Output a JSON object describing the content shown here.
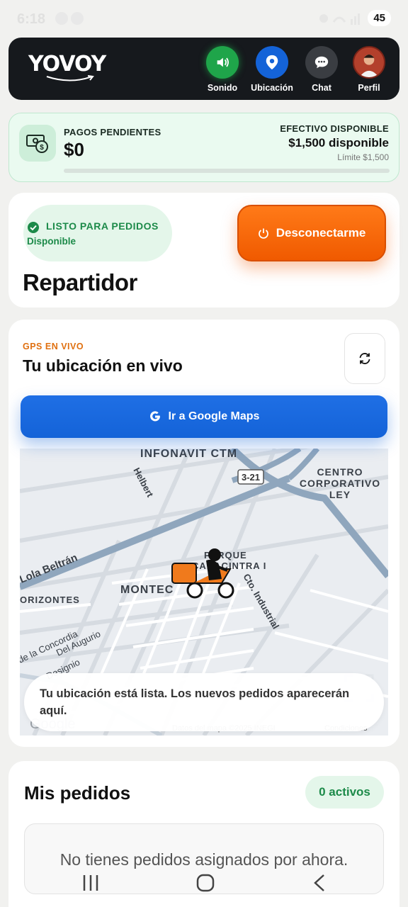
{
  "status_bar": {
    "time": "6:18",
    "battery": "45"
  },
  "header": {
    "logo": "YOVOY",
    "buttons": [
      {
        "label": "Sonido",
        "icon": "speaker-icon",
        "color": "#1fa54a"
      },
      {
        "label": "Ubicación",
        "icon": "location-pin-icon",
        "color": "#1463d8"
      },
      {
        "label": "Chat",
        "icon": "chat-bubble-icon",
        "color": "#3a3d42"
      },
      {
        "label": "Perfil",
        "icon": "avatar",
        "color": "#a33323"
      }
    ]
  },
  "pagos": {
    "title": "PAGOS PENDIENTES",
    "value": "$0",
    "efectivo_title": "EFECTIVO DISPONIBLE",
    "efectivo_value": "$1,500 disponible",
    "limite": "Límite $1,500",
    "progress_fraction": 0.0
  },
  "status": {
    "badge_title": "LISTO PARA PEDIDOS",
    "badge_sub": "Disponible",
    "disconnect_label": "Desconectarme",
    "role": "Repartidor"
  },
  "gps": {
    "label": "GPS EN VIVO",
    "title": "Tu ubicación en vivo",
    "maps_button": "Ir a Google Maps",
    "map_labels": {
      "infonavit": "INFONAVIT CTM",
      "centro": "CENTRO",
      "corporativo": "CORPORATIVO",
      "ley": "LEY",
      "helbert": "Helbert",
      "road": "3-21",
      "lola": "Lola Beltrán",
      "parque": "PARQUE",
      "canacintra": "CANACINTRA I",
      "montec": "MONTEC",
      "cto": "Cto. Industrial",
      "horizontes": "ORIZONTES",
      "concordia": "de la Concordia",
      "augurio": "Del Augurio",
      "designio": "Designio",
      "google": "Google",
      "datos": "Datos del mapa ©2025 INEGI",
      "condiciones": "Condiciones"
    },
    "toast": "Tu ubicación está lista. Los nuevos pedidos aparecerán aquí."
  },
  "pedidos": {
    "title": "Mis pedidos",
    "count_badge": "0 activos",
    "empty_text": "No tienes pedidos asignados por ahora."
  }
}
